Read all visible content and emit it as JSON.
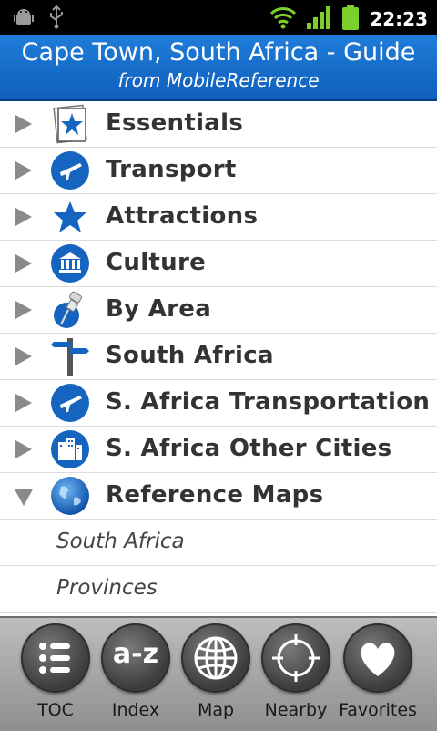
{
  "status_bar": {
    "time": "22:23",
    "icons": [
      "android-debug-icon",
      "usb-icon",
      "wifi-icon",
      "signal-icon",
      "battery-icon"
    ]
  },
  "header": {
    "title": "Cape Town, South Africa - Guide",
    "subtitle": "from MobileReference"
  },
  "list": {
    "items": [
      {
        "label": "Essentials",
        "icon": "essentials-icon",
        "expanded": false
      },
      {
        "label": "Transport",
        "icon": "airplane-icon",
        "expanded": false
      },
      {
        "label": "Attractions",
        "icon": "star-icon",
        "expanded": false
      },
      {
        "label": "Culture",
        "icon": "museum-icon",
        "expanded": false
      },
      {
        "label": "By Area",
        "icon": "pushpin-icon",
        "expanded": false
      },
      {
        "label": "South Africa",
        "icon": "signpost-icon",
        "expanded": false
      },
      {
        "label": "S. Africa Transportation",
        "icon": "airplane-icon",
        "expanded": false
      },
      {
        "label": "S. Africa Other Cities",
        "icon": "city-icon",
        "expanded": false
      },
      {
        "label": "Reference Maps",
        "icon": "globe-icon",
        "expanded": true
      }
    ],
    "subitems": [
      {
        "label": "South Africa"
      },
      {
        "label": "Provinces"
      }
    ]
  },
  "toolbar": {
    "buttons": [
      {
        "label": "TOC",
        "icon": "list-icon"
      },
      {
        "label": "Index",
        "icon": "a-z-icon",
        "glyph": "a-z"
      },
      {
        "label": "Map",
        "icon": "globe-icon"
      },
      {
        "label": "Nearby",
        "icon": "crosshair-icon"
      },
      {
        "label": "Favorites",
        "icon": "heart-icon"
      }
    ]
  },
  "colors": {
    "header_blue": "#1a73d0",
    "icon_blue": "#1565c0",
    "toolbar_gray": "#a8a8a8"
  }
}
